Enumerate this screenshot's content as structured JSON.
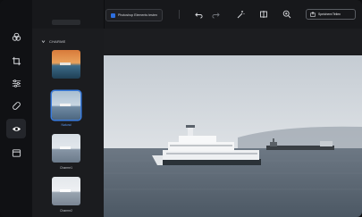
{
  "toolbar": {
    "home_label": "Photoshop Elements testen",
    "save_label": "Speichern/Teilen",
    "icons": [
      "undo-icon",
      "redo-icon",
      "magic-wand-icon",
      "compare-icon",
      "zoom-icon"
    ]
  },
  "rail": {
    "items": [
      "layers-icon",
      "crop-icon",
      "adjust-icon",
      "heal-icon",
      "eye-icon",
      "frame-icon"
    ],
    "active": "eye-icon"
  },
  "panel": {
    "section_title": "CHARME",
    "thumbs": [
      {
        "label": ""
      },
      {
        "label": "Natural"
      },
      {
        "label": "Charme1"
      },
      {
        "label": "Charme2"
      }
    ],
    "selected_index": 1
  },
  "colors": {
    "accent": "#3a7de0",
    "bg": "#141518",
    "panel": "#1b1c1f"
  }
}
